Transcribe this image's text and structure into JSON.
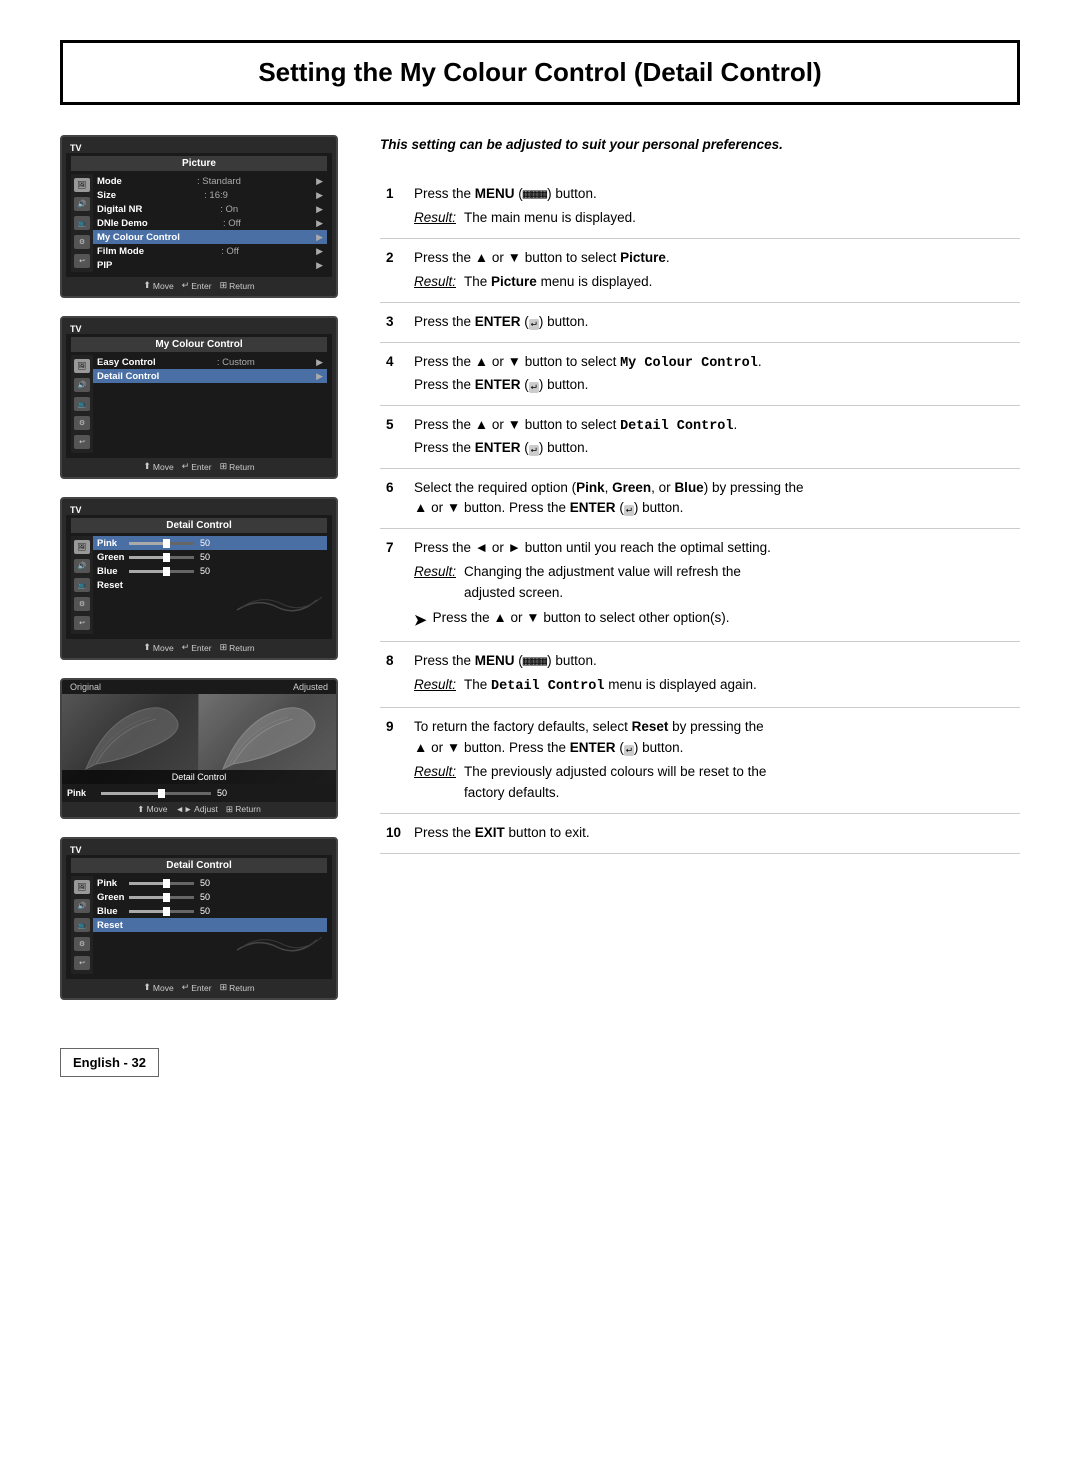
{
  "page": {
    "title": "Setting the My Colour Control (Detail Control)",
    "intro": "This setting can be adjusted to suit your personal preferences.",
    "footer": "English - 32"
  },
  "steps": [
    {
      "num": "1",
      "text": "Press the MENU (   ) button.",
      "result_label": "Result:",
      "result_text": "The main menu is displayed."
    },
    {
      "num": "2",
      "text": "Press the ▲ or ▼ button to select Picture.",
      "result_label": "Result:",
      "result_text": "The Picture menu is displayed."
    },
    {
      "num": "3",
      "text": "Press the ENTER (   ) button."
    },
    {
      "num": "4",
      "text": "Press the ▲ or ▼ button to select My Colour Control.\nPress the ENTER (   ) button."
    },
    {
      "num": "5",
      "text": "Press the ▲ or ▼ button to select Detail Control.\nPress the ENTER (   ) button."
    },
    {
      "num": "6",
      "text": "Select the required option (Pink, Green, or Blue) by pressing the ▲ or ▼ button. Press the ENTER (   ) button."
    },
    {
      "num": "7",
      "text": "Press the ◄ or ► button until you reach the optimal setting.",
      "result_label": "Result:",
      "result_text": "Changing the adjustment value will refresh the adjusted screen.",
      "note": "Press the ▲ or ▼ button to select other option(s)."
    },
    {
      "num": "8",
      "text": "Press the MENU (   ) button.",
      "result_label": "Result:",
      "result_text": "The Detail Control menu is displayed again."
    },
    {
      "num": "9",
      "text": "To return the factory defaults, select Reset by pressing the ▲ or ▼ button. Press the ENTER (   ) button.",
      "result_label": "Result:",
      "result_text": "The previously adjusted colours will be reset to the factory defaults."
    },
    {
      "num": "10",
      "text": "Press the EXIT button to exit."
    }
  ],
  "screens": [
    {
      "id": "screen1",
      "label": "TV",
      "header": "Picture",
      "rows": [
        {
          "label": "Mode",
          "value": ": Standard",
          "arrow": true
        },
        {
          "label": "Size",
          "value": ": 16:9",
          "arrow": true
        },
        {
          "label": "Digital NR",
          "value": ": On",
          "arrow": true
        },
        {
          "label": "DNIe Demo",
          "value": ": Off",
          "arrow": true
        },
        {
          "label": "My Colour Control",
          "value": "",
          "arrow": true,
          "selected": true
        },
        {
          "label": "Film Mode",
          "value": ": Off",
          "arrow": true
        },
        {
          "label": "PIP",
          "value": "",
          "arrow": true
        }
      ],
      "footer": [
        "⬆ Move",
        "↵ Enter",
        "⊞ Return"
      ]
    },
    {
      "id": "screen2",
      "label": "TV",
      "header": "My Colour Control",
      "rows": [
        {
          "label": "Easy Control",
          "value": ": Custom",
          "arrow": true
        },
        {
          "label": "Detail Control",
          "value": "",
          "arrow": true,
          "selected": true
        }
      ],
      "footer": [
        "⬆ Move",
        "↵ Enter",
        "⊞ Return"
      ]
    },
    {
      "id": "screen3",
      "label": "TV",
      "header": "Detail Control",
      "rows": [
        {
          "label": "Pink",
          "slider": true,
          "value": "50",
          "selected": true
        },
        {
          "label": "Green",
          "slider": true,
          "value": "50"
        },
        {
          "label": "Blue",
          "slider": true,
          "value": "50"
        },
        {
          "label": "Reset",
          "value": ""
        }
      ],
      "footer": [
        "⬆ Move",
        "↵ Enter",
        "⊞ Return"
      ]
    },
    {
      "id": "screen4_split",
      "label_original": "Original",
      "label_adjusted": "Adjusted",
      "overlay": "Detail Control",
      "slider_label": "Pink",
      "slider_value": "50",
      "footer": [
        "⬆ Move",
        "◄► Adjust",
        "⊞ Return"
      ]
    },
    {
      "id": "screen5",
      "label": "TV",
      "header": "Detail Control",
      "rows": [
        {
          "label": "Pink",
          "slider": true,
          "value": "50"
        },
        {
          "label": "Green",
          "slider": true,
          "value": "50"
        },
        {
          "label": "Blue",
          "slider": true,
          "value": "50"
        },
        {
          "label": "Reset",
          "value": "",
          "selected": true
        }
      ],
      "footer": [
        "⬆ Move",
        "↵ Enter",
        "⊞ Return"
      ]
    }
  ],
  "icons": {
    "move": "⬆",
    "enter": "↵",
    "return": "⊞",
    "adjust": "◄►"
  }
}
